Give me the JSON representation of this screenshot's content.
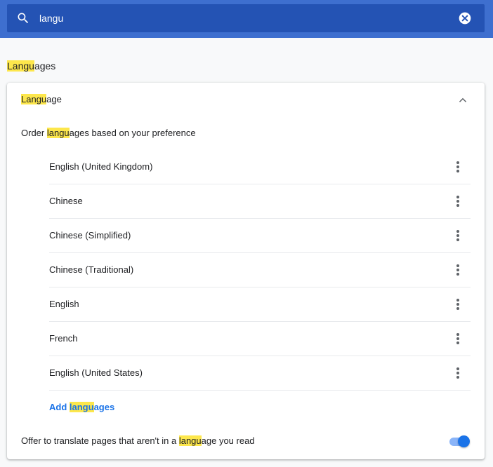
{
  "colors": {
    "header_bg": "#3e6fcf",
    "search_bg": "#2453b4",
    "highlight": "#fde74c",
    "link": "#1a73e8",
    "toggle_on": "#1a73e8"
  },
  "search": {
    "value": "langu",
    "icon": "search-icon",
    "clear_icon": "close-icon"
  },
  "section": {
    "title_hl": "Langu",
    "title_rest": "ages"
  },
  "card": {
    "header_hl": "Langu",
    "header_rest": "age",
    "header_icon": "chevron-up-icon",
    "order_pre": "Order ",
    "order_hl": "langu",
    "order_post": "ages based on your preference",
    "languages": [
      "English (United Kingdom)",
      "Chinese",
      "Chinese (Simplified)",
      "Chinese (Traditional)",
      "English",
      "French",
      "English (United States)"
    ],
    "row_menu_icon": "more-vert-icon",
    "add_pre": "Add ",
    "add_hl": "langu",
    "add_post": "ages",
    "offer_pre": "Offer to translate pages that aren't in a ",
    "offer_hl": "langu",
    "offer_post": "age you read",
    "offer_toggle_on": true
  }
}
